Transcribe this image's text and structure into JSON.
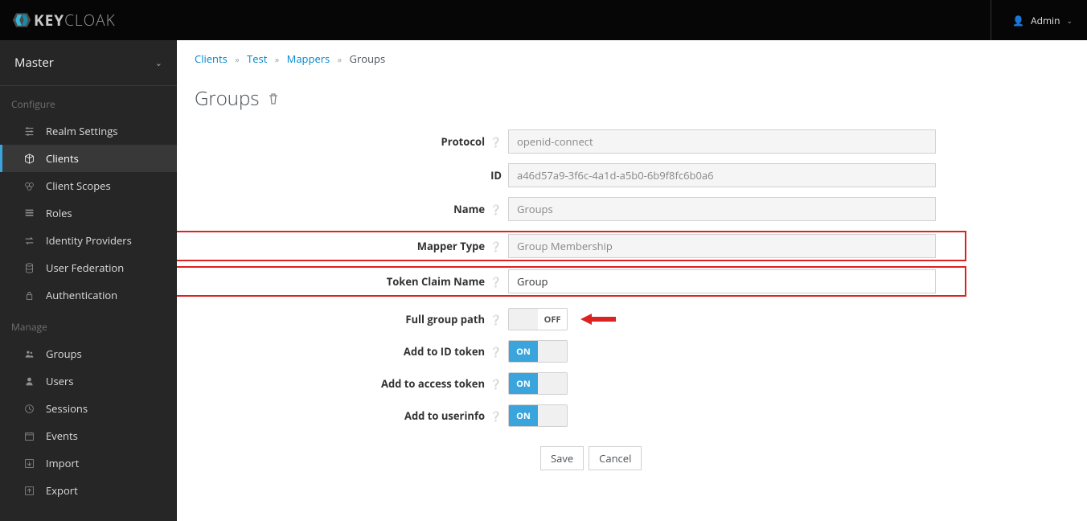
{
  "topbar": {
    "user": "Admin",
    "logo_a": "KEY",
    "logo_b": "CLOAK"
  },
  "realm": {
    "name": "Master"
  },
  "sections": {
    "configure": "Configure",
    "manage": "Manage"
  },
  "nav_configure": [
    {
      "icon": "sliders",
      "label": "Realm Settings"
    },
    {
      "icon": "cube",
      "label": "Clients"
    },
    {
      "icon": "layers",
      "label": "Client Scopes"
    },
    {
      "icon": "list",
      "label": "Roles"
    },
    {
      "icon": "exchange",
      "label": "Identity Providers"
    },
    {
      "icon": "db",
      "label": "User Federation"
    },
    {
      "icon": "lock",
      "label": "Authentication"
    }
  ],
  "nav_manage": [
    {
      "icon": "group",
      "label": "Groups"
    },
    {
      "icon": "user",
      "label": "Users"
    },
    {
      "icon": "clock",
      "label": "Sessions"
    },
    {
      "icon": "cal",
      "label": "Events"
    },
    {
      "icon": "import",
      "label": "Import"
    },
    {
      "icon": "export",
      "label": "Export"
    }
  ],
  "crumbs": {
    "a": "Clients",
    "b": "Test",
    "c": "Mappers",
    "d": "Groups"
  },
  "title": "Groups",
  "form": {
    "protocol": {
      "label": "Protocol",
      "value": "openid-connect"
    },
    "id": {
      "label": "ID",
      "value": "a46d57a9-3f6c-4a1d-a5b0-6b9f8fc6b0a6"
    },
    "name": {
      "label": "Name",
      "value": "Groups"
    },
    "mapper_type": {
      "label": "Mapper Type",
      "value": "Group Membership"
    },
    "token_claim": {
      "label": "Token Claim Name",
      "value": "Group"
    },
    "full_group_path": {
      "label": "Full group path",
      "state": "OFF"
    },
    "add_id_token": {
      "label": "Add to ID token",
      "state": "ON"
    },
    "add_access_token": {
      "label": "Add to access token",
      "state": "ON"
    },
    "add_userinfo": {
      "label": "Add to userinfo",
      "state": "ON"
    }
  },
  "buttons": {
    "save": "Save",
    "cancel": "Cancel"
  },
  "icons": {
    "sliders": "⎚",
    "cube": "◧",
    "layers": "☷",
    "list": "≣",
    "exchange": "⇄",
    "db": "≡",
    "lock": "🔒",
    "group": "👥",
    "user": "👤",
    "clock": "◷",
    "cal": "📅",
    "import": "⇥",
    "export": "⇤"
  }
}
